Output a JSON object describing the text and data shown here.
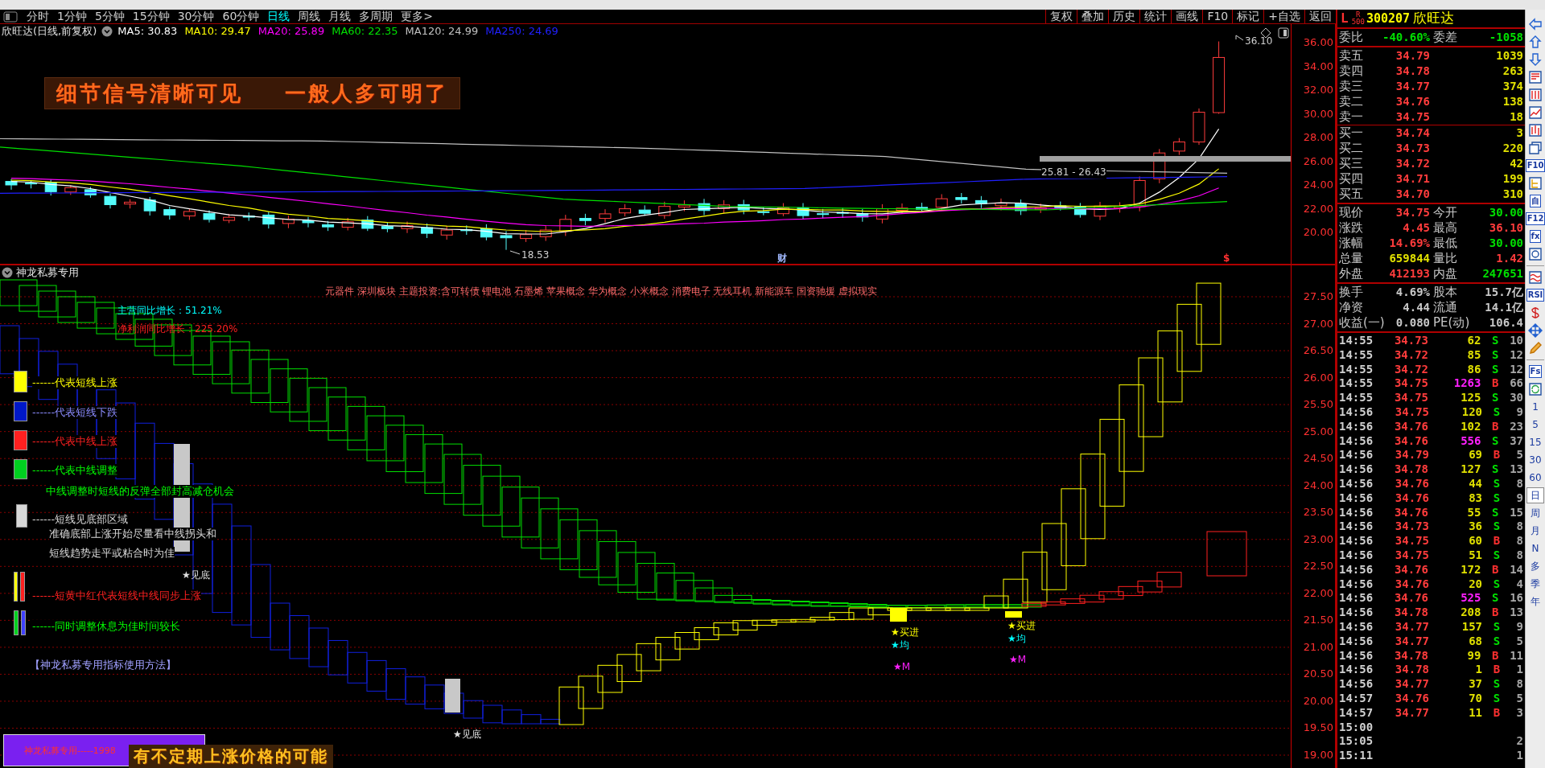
{
  "period_bar": {
    "tabs": [
      {
        "label": "分时",
        "selected": false
      },
      {
        "label": "1分钟",
        "selected": false
      },
      {
        "label": "5分钟",
        "selected": false
      },
      {
        "label": "15分钟",
        "selected": false
      },
      {
        "label": "30分钟",
        "selected": false
      },
      {
        "label": "60分钟",
        "selected": false
      },
      {
        "label": "日线",
        "selected": true
      },
      {
        "label": "周线",
        "selected": false
      },
      {
        "label": "月线",
        "selected": false
      },
      {
        "label": "多周期",
        "selected": false
      },
      {
        "label": "更多>",
        "selected": false
      }
    ],
    "buttons": [
      "复权",
      "叠加",
      "历史",
      "统计",
      "画线",
      "F10",
      "标记",
      "+自选",
      "返回"
    ]
  },
  "main_chart": {
    "title": "欣旺达(日线,前复权)",
    "moving_averages": [
      {
        "label": "MA5: 30.83",
        "color": "#ffffff"
      },
      {
        "label": "MA10: 29.47",
        "color": "#ffff00"
      },
      {
        "label": "MA20: 25.89",
        "color": "#ff00ff"
      },
      {
        "label": "MA60: 22.35",
        "color": "#00e000"
      },
      {
        "label": "MA120: 24.99",
        "color": "#c0c0c0"
      },
      {
        "label": "MA250: 24.69",
        "color": "#2020ff"
      }
    ],
    "banner": [
      "细节信号清晰可见",
      "一般人多可明了"
    ],
    "high_label": "36.10",
    "low_label": "18.53",
    "range_label": "25.81 - 26.43",
    "event_marks": [
      {
        "text": "财",
        "kind": "finance"
      },
      {
        "text": "$",
        "kind": "dividend"
      }
    ],
    "price_axis": [
      "36.00",
      "34.00",
      "32.00",
      "30.00",
      "28.00",
      "26.00",
      "24.00",
      "22.00",
      "20.00"
    ]
  },
  "indicator": {
    "title": "神龙私募专用",
    "concepts": "元器件 深圳板块 主题投资:含可转债 锂电池 石墨烯 苹果概念 华为概念 小米概念 消费电子 无线耳机 新能源车 国资驰援 虚拟现实",
    "growth": [
      {
        "text": "主营同比增长：51.21%",
        "kind": "revenue"
      },
      {
        "text": "净利润同比增长：225.20%",
        "kind": "profit"
      }
    ],
    "legend": [
      {
        "kind": "swatch",
        "swatches": [
          {
            "color": "#ffff00"
          }
        ],
        "text": "------代表短线上涨",
        "color": "#ffff00"
      },
      {
        "kind": "swatch",
        "swatches": [
          {
            "color": "#0018c8"
          }
        ],
        "text": "------代表短线下跌",
        "color": "#8c8cff"
      },
      {
        "kind": "swatch",
        "swatches": [
          {
            "color": "#ff2020"
          }
        ],
        "text": "------代表中线上涨",
        "color": "#ff2020"
      },
      {
        "kind": "swatch",
        "swatches": [
          {
            "color": "#00d020"
          }
        ],
        "text": "------代表中线调整",
        "color": "#00ff00"
      },
      {
        "kind": "note",
        "text": "中线调整时短线的反弹全部封高减仓机会",
        "color": "#00ff00"
      },
      {
        "kind": "swatch",
        "swatches": [
          {
            "color": "#d8d8d8"
          }
        ],
        "text": "------短线见底部区域",
        "color": "#d8d8d8"
      },
      {
        "kind": "note",
        "text": "准确底部上涨开始尽量看中线拐头和",
        "color": "#d8d8d8"
      },
      {
        "kind": "note",
        "text": "短线趋势走平或粘合时为佳",
        "color": "#d8d8d8"
      },
      {
        "kind": "swatch",
        "swatches": [
          {
            "color": "#ffff00"
          },
          {
            "color": "#ff2020"
          }
        ],
        "text": "------短黄中红代表短线中线同步上涨",
        "color": "#ff2020"
      },
      {
        "kind": "swatch",
        "swatches": [
          {
            "color": "#00d020"
          },
          {
            "color": "#4040ff"
          }
        ],
        "text": "------同时调整休息为佳时间较长",
        "color": "#00ff00"
      }
    ],
    "method_link": "【神龙私募专用指标使用方法】",
    "signals": [
      {
        "text": "★见底",
        "kind": "bottom"
      },
      {
        "text": "★见底",
        "kind": "bottom"
      },
      {
        "text": "★买进",
        "kind": "buy"
      },
      {
        "text": "★均",
        "kind": "average"
      },
      {
        "text": "★M",
        "kind": "m"
      },
      {
        "text": "★买进",
        "kind": "buy"
      },
      {
        "text": "★均",
        "kind": "average"
      },
      {
        "text": "★M",
        "kind": "m"
      }
    ],
    "footer_box": "神龙私募专用-----1998",
    "footer_banner": "有不定期上涨价格的可能",
    "price_axis": [
      "27.50",
      "27.00",
      "26.50",
      "26.00",
      "25.50",
      "25.00",
      "24.50",
      "24.00",
      "23.50",
      "23.00",
      "22.50",
      "22.00",
      "21.50",
      "21.00",
      "20.50",
      "20.00",
      "19.50",
      "19.00"
    ]
  },
  "quote": {
    "flag": "L",
    "rank": [
      "R",
      "500"
    ],
    "code": "300207",
    "name": "欣旺达",
    "ratio_row": [
      {
        "text": "委比",
        "kind": "label"
      },
      {
        "text": "-40.60%",
        "kind": "down"
      },
      {
        "text": "委差",
        "kind": "label"
      },
      {
        "text": "-1058",
        "kind": "down"
      }
    ],
    "asks": [
      {
        "label": "卖五",
        "price": "34.79",
        "volume": "1039"
      },
      {
        "label": "卖四",
        "price": "34.78",
        "volume": "263"
      },
      {
        "label": "卖三",
        "price": "34.77",
        "volume": "374"
      },
      {
        "label": "卖二",
        "price": "34.76",
        "volume": "138"
      },
      {
        "label": "卖一",
        "price": "34.75",
        "volume": "18"
      }
    ],
    "bids": [
      {
        "label": "买一",
        "price": "34.74",
        "volume": "3"
      },
      {
        "label": "买二",
        "price": "34.73",
        "volume": "220"
      },
      {
        "label": "买三",
        "price": "34.72",
        "volume": "42"
      },
      {
        "label": "买四",
        "price": "34.71",
        "volume": "199"
      },
      {
        "label": "买五",
        "price": "34.70",
        "volume": "310"
      }
    ],
    "stats": [
      [
        {
          "text": "现价",
          "kind": "label"
        },
        {
          "text": "34.75",
          "kind": "up"
        },
        {
          "text": "今开",
          "kind": "label"
        },
        {
          "text": "30.00",
          "kind": "down"
        }
      ],
      [
        {
          "text": "涨跌",
          "kind": "label"
        },
        {
          "text": "4.45",
          "kind": "up"
        },
        {
          "text": "最高",
          "kind": "label"
        },
        {
          "text": "36.10",
          "kind": "up"
        }
      ],
      [
        {
          "text": "涨幅",
          "kind": "label"
        },
        {
          "text": "14.69%",
          "kind": "up"
        },
        {
          "text": "最低",
          "kind": "label"
        },
        {
          "text": "30.00",
          "kind": "down"
        }
      ],
      [
        {
          "text": "总量",
          "kind": "label"
        },
        {
          "text": "659844",
          "kind": "volume"
        },
        {
          "text": "量比",
          "kind": "label"
        },
        {
          "text": "1.42",
          "kind": "up"
        }
      ],
      [
        {
          "text": "外盘",
          "kind": "label"
        },
        {
          "text": "412193",
          "kind": "up"
        },
        {
          "text": "内盘",
          "kind": "label"
        },
        {
          "text": "247651",
          "kind": "down"
        }
      ]
    ],
    "fundamentals": [
      [
        {
          "text": "换手",
          "kind": "label"
        },
        {
          "text": "4.69%",
          "kind": "plain"
        },
        {
          "text": "股本",
          "kind": "label"
        },
        {
          "text": "15.7亿",
          "kind": "plain"
        }
      ],
      [
        {
          "text": "净资",
          "kind": "label"
        },
        {
          "text": "4.44",
          "kind": "plain"
        },
        {
          "text": "流通",
          "kind": "label"
        },
        {
          "text": "14.1亿",
          "kind": "plain"
        }
      ],
      [
        {
          "text": "收益(一)",
          "kind": "label"
        },
        {
          "text": "0.080",
          "kind": "plain"
        },
        {
          "text": "PE(动)",
          "kind": "label"
        },
        {
          "text": "106.4",
          "kind": "plain"
        }
      ]
    ],
    "trades": [
      {
        "time": "14:55",
        "price": "34.73",
        "volume": "62",
        "large": false,
        "side": "S",
        "kind": "sell",
        "count": "10"
      },
      {
        "time": "14:55",
        "price": "34.72",
        "volume": "85",
        "large": false,
        "side": "S",
        "kind": "sell",
        "count": "12"
      },
      {
        "time": "14:55",
        "price": "34.72",
        "volume": "86",
        "large": false,
        "side": "S",
        "kind": "sell",
        "count": "12"
      },
      {
        "time": "14:55",
        "price": "34.75",
        "volume": "1263",
        "large": true,
        "side": "B",
        "kind": "buy",
        "count": "66"
      },
      {
        "time": "14:55",
        "price": "34.75",
        "volume": "125",
        "large": false,
        "side": "S",
        "kind": "sell",
        "count": "30"
      },
      {
        "time": "14:56",
        "price": "34.75",
        "volume": "120",
        "large": false,
        "side": "S",
        "kind": "sell",
        "count": "9"
      },
      {
        "time": "14:56",
        "price": "34.76",
        "volume": "102",
        "large": false,
        "side": "B",
        "kind": "buy",
        "count": "23"
      },
      {
        "time": "14:56",
        "price": "34.76",
        "volume": "556",
        "large": true,
        "side": "S",
        "kind": "sell",
        "count": "37"
      },
      {
        "time": "14:56",
        "price": "34.79",
        "volume": "69",
        "large": false,
        "side": "B",
        "kind": "buy",
        "count": "5"
      },
      {
        "time": "14:56",
        "price": "34.78",
        "volume": "127",
        "large": false,
        "side": "S",
        "kind": "sell",
        "count": "13"
      },
      {
        "time": "14:56",
        "price": "34.76",
        "volume": "44",
        "large": false,
        "side": "S",
        "kind": "sell",
        "count": "8"
      },
      {
        "time": "14:56",
        "price": "34.76",
        "volume": "83",
        "large": false,
        "side": "S",
        "kind": "sell",
        "count": "9"
      },
      {
        "time": "14:56",
        "price": "34.76",
        "volume": "55",
        "large": false,
        "side": "S",
        "kind": "sell",
        "count": "15"
      },
      {
        "time": "14:56",
        "price": "34.73",
        "volume": "36",
        "large": false,
        "side": "S",
        "kind": "sell",
        "count": "8"
      },
      {
        "time": "14:56",
        "price": "34.75",
        "volume": "60",
        "large": false,
        "side": "B",
        "kind": "buy",
        "count": "8"
      },
      {
        "time": "14:56",
        "price": "34.75",
        "volume": "51",
        "large": false,
        "side": "S",
        "kind": "sell",
        "count": "8"
      },
      {
        "time": "14:56",
        "price": "34.76",
        "volume": "172",
        "large": false,
        "side": "B",
        "kind": "buy",
        "count": "14"
      },
      {
        "time": "14:56",
        "price": "34.76",
        "volume": "20",
        "large": false,
        "side": "S",
        "kind": "sell",
        "count": "4"
      },
      {
        "time": "14:56",
        "price": "34.76",
        "volume": "525",
        "large": true,
        "side": "S",
        "kind": "sell",
        "count": "16"
      },
      {
        "time": "14:56",
        "price": "34.78",
        "volume": "208",
        "large": false,
        "side": "B",
        "kind": "buy",
        "count": "13"
      },
      {
        "time": "14:56",
        "price": "34.77",
        "volume": "157",
        "large": false,
        "side": "S",
        "kind": "sell",
        "count": "9"
      },
      {
        "time": "14:56",
        "price": "34.77",
        "volume": "68",
        "large": false,
        "side": "S",
        "kind": "sell",
        "count": "5"
      },
      {
        "time": "14:56",
        "price": "34.78",
        "volume": "99",
        "large": false,
        "side": "B",
        "kind": "buy",
        "count": "11"
      },
      {
        "time": "14:56",
        "price": "34.78",
        "volume": "1",
        "large": false,
        "side": "B",
        "kind": "buy",
        "count": "1"
      },
      {
        "time": "14:56",
        "price": "34.77",
        "volume": "37",
        "large": false,
        "side": "S",
        "kind": "sell",
        "count": "8"
      },
      {
        "time": "14:57",
        "price": "34.76",
        "volume": "70",
        "large": false,
        "side": "S",
        "kind": "sell",
        "count": "5"
      },
      {
        "time": "14:57",
        "price": "34.77",
        "volume": "11",
        "large": false,
        "side": "B",
        "kind": "buy",
        "count": "3"
      },
      {
        "time": "15:00"
      },
      {
        "time": "15:05",
        "count": "2"
      },
      {
        "time": "15:11",
        "count": "1"
      }
    ]
  },
  "side_toolbar": {
    "labeled_icons": [
      "F10",
      "自",
      "F12",
      "fx",
      "RSI",
      "Fs"
    ],
    "periods": [
      {
        "label": "1",
        "selected": false
      },
      {
        "label": "5",
        "selected": false
      },
      {
        "label": "15",
        "selected": false
      },
      {
        "label": "30",
        "selected": false
      },
      {
        "label": "60",
        "selected": false
      },
      {
        "label": "日",
        "selected": true
      },
      {
        "label": "周",
        "selected": false
      },
      {
        "label": "月",
        "selected": false
      },
      {
        "label": "N",
        "selected": false
      },
      {
        "label": "多",
        "selected": false
      },
      {
        "label": "季",
        "selected": false
      },
      {
        "label": "年",
        "selected": false
      }
    ]
  }
}
